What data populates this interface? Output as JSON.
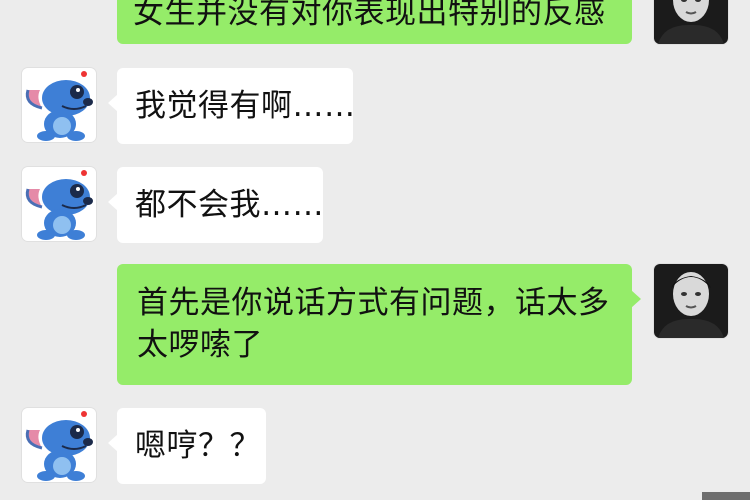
{
  "app": {
    "background_color": "#ececec",
    "self_bubble_color": "#95ec69",
    "other_bubble_color": "#ffffff"
  },
  "messages": [
    {
      "sender": "self",
      "avatar_icon": "black-white-person-photo-icon",
      "text": "女生并没有对你表现出特别的反感"
    },
    {
      "sender": "other",
      "avatar_icon": "blue-cartoon-creature-icon",
      "text": "我觉得有啊……"
    },
    {
      "sender": "other",
      "avatar_icon": "blue-cartoon-creature-icon",
      "text": "都不会我……"
    },
    {
      "sender": "self",
      "avatar_icon": "black-white-person-photo-icon",
      "text": "首先是你说话方式有问题，话太多太啰嗦了"
    },
    {
      "sender": "other",
      "avatar_icon": "blue-cartoon-creature-icon",
      "text": "嗯哼？？"
    }
  ]
}
